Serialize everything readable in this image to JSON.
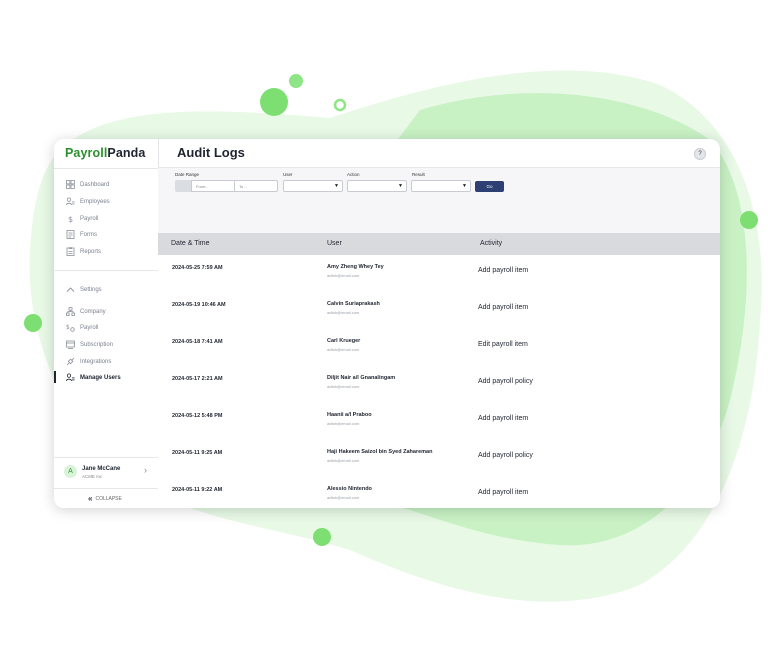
{
  "colors": {
    "brand_green": "#2c8f2e",
    "blob_light": "#e8f9e6",
    "blob_mid": "#c8f1c4",
    "dot_green": "#7ddf72",
    "go_button": "#2e3f73",
    "table_header_bg": "#d9dadd"
  },
  "brand": {
    "part1": "Payroll",
    "part2": "Panda"
  },
  "sidebar": {
    "main_items": [
      {
        "label": "Dashboard",
        "icon": "dashboard-icon"
      },
      {
        "label": "Employees",
        "icon": "employees-icon"
      },
      {
        "label": "Payroll",
        "icon": "payroll-dollar-icon"
      },
      {
        "label": "Forms",
        "icon": "forms-icon"
      },
      {
        "label": "Reports",
        "icon": "reports-icon"
      }
    ],
    "settings_label": "Settings",
    "settings_items": [
      {
        "label": "Company",
        "icon": "company-icon"
      },
      {
        "label": "Payroll",
        "icon": "payroll-settings-icon"
      },
      {
        "label": "Subscription",
        "icon": "subscription-icon"
      },
      {
        "label": "Integrations",
        "icon": "integrations-icon"
      },
      {
        "label": "Manage Users",
        "icon": "manage-users-icon",
        "active": true
      }
    ],
    "user": {
      "initial": "A",
      "name": "Jane McCane",
      "company": "ACME Inc"
    },
    "collapse_label": "COLLAPSE"
  },
  "header": {
    "title": "Audit Logs",
    "help_icon": "help-icon"
  },
  "filters": {
    "date_range_label": "Date Range",
    "from_placeholder": "From..",
    "to_placeholder": "To ..",
    "user_label": "User",
    "action_label": "Action",
    "result_label": "Result",
    "go_label": "Go"
  },
  "table": {
    "columns": [
      "Date & Time",
      "User",
      "Activity"
    ],
    "rows": [
      {
        "datetime": "2024-05-25 7:59 AM",
        "user": "Amy Zheng Whey Tey",
        "email": "adfah@email.com",
        "activity": "Add payroll item"
      },
      {
        "datetime": "2024-05-19 10:46 AM",
        "user": "Calvin Suriaprakash",
        "email": "adfah@email.com",
        "activity": "Add payroll item"
      },
      {
        "datetime": "2024-05-18 7:41 AM",
        "user": "Carl Krueger",
        "email": "adfah@email.com",
        "activity": "Edit payroll item"
      },
      {
        "datetime": "2024-05-17 2:21 AM",
        "user": "Diljit Nair a/l Gnanalingam",
        "email": "adfah@email.com",
        "activity": "Add payroll policy"
      },
      {
        "datetime": "2024-05-12 5:48 PM",
        "user": "Haanii a/l Praboo",
        "email": "adfah@email.com",
        "activity": "Add payroll item"
      },
      {
        "datetime": "2024-05-11 9:25 AM",
        "user": "Haji Hakeem Saizol bin Syed Zahareman",
        "email": "adfah@email.com",
        "activity": "Add payroll policy"
      },
      {
        "datetime": "2024-05-11 9:22 AM",
        "user": "Alessio Nintendo",
        "email": "adfah@email.com",
        "activity": "Add payroll item"
      }
    ]
  }
}
